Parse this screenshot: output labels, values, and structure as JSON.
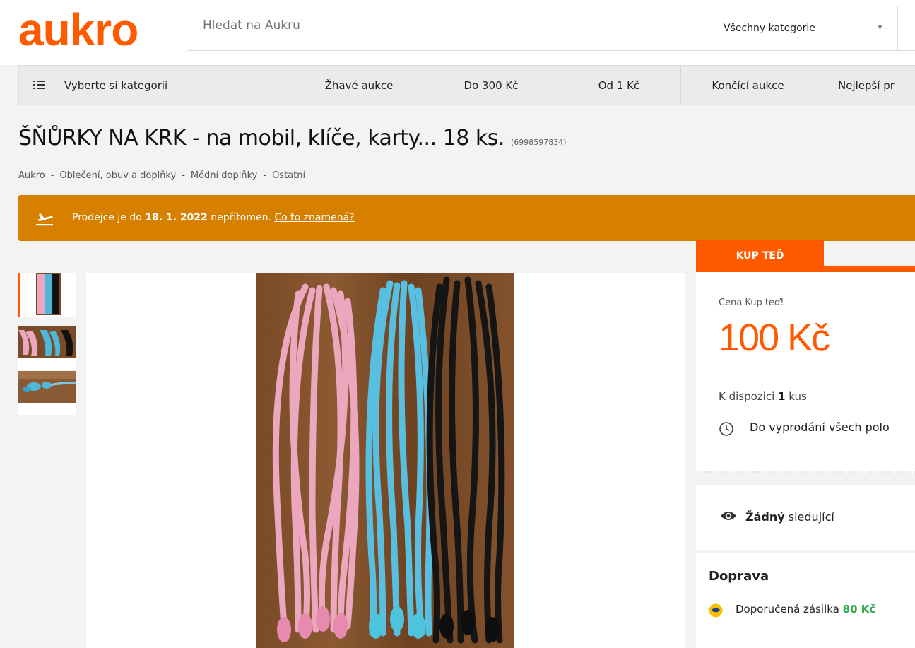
{
  "header": {
    "logo": "aukro",
    "search_placeholder": "Hledat na Aukru",
    "category_select": "Všechny kategorie"
  },
  "nav": {
    "categories": "Vyberte si kategorii",
    "items": [
      "Žhavé aukce",
      "Do 300 Kč",
      "Od 1 Kč",
      "Končící aukce",
      "Nejlepší pr"
    ]
  },
  "listing": {
    "title": "ŠŇŮRKY NA KRK - na mobil, klíče, karty... 18 ks.",
    "id": "(6998597834)",
    "breadcrumb": [
      "Aukro",
      "Oblečení, obuv a doplňky",
      "Módní doplňky",
      "Ostatní"
    ]
  },
  "banner": {
    "prefix": "Prodejce je do",
    "date": "18. 1. 2022",
    "suffix": "nepřítomen.",
    "link": "Co to znamená?",
    "color": "#d78000"
  },
  "buy": {
    "tab": "KUP TEĎ",
    "price_label": "Cena Kup teď!",
    "price": "100 Kč",
    "avail_prefix": "K dispozici",
    "avail_count": "1",
    "avail_suffix": "kus",
    "soldout": "Do vyprodání všech polo"
  },
  "watch": {
    "bold": "Žádný",
    "rest": "sledující"
  },
  "shipping": {
    "title": "Doprava",
    "method": "Doporučená zásilka",
    "price": "80 Kč"
  },
  "colors": {
    "brand": "#ff5a00",
    "banner": "#d78000",
    "ship_price": "#2aa84a"
  }
}
